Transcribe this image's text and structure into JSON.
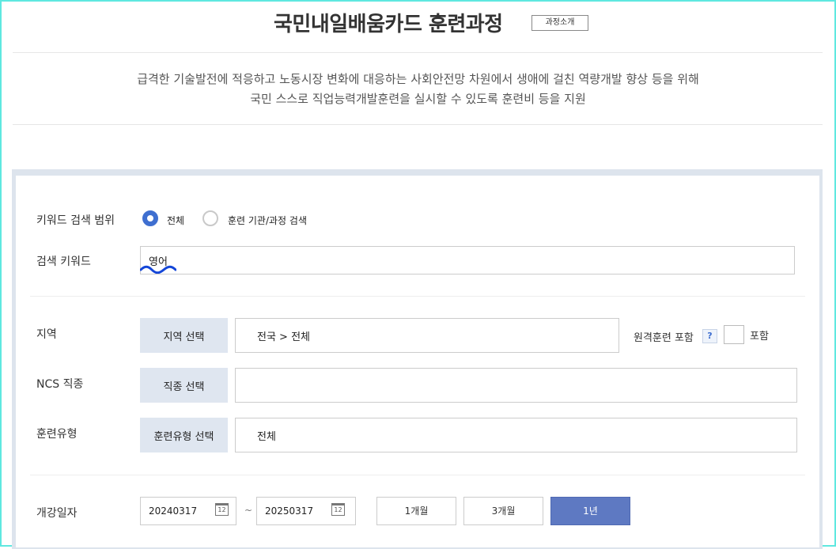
{
  "header": {
    "title": "국민내일배움카드 훈련과정",
    "intro_button": "과정소개"
  },
  "description": {
    "line1": "급격한 기술발전에 적응하고 노동시장 변화에 대응하는 사회안전망 차원에서 생애에 걸친 역량개발 향상 등을 위해",
    "line2": "국민 스스로 직업능력개발훈련을 실시할 수 있도록 훈련비 등을 지원"
  },
  "search": {
    "scope_label": "키워드 검색 범위",
    "scope_options": [
      {
        "label": "전체",
        "selected": true
      },
      {
        "label": "훈련 기관/과정 검색",
        "selected": false
      }
    ],
    "keyword_label": "검색 키워드",
    "keyword_value": "영어",
    "region_label": "지역",
    "region_button": "지역 선택",
    "region_value": "전국 > 전체",
    "remote_label": "원격훈련 포함",
    "remote_help": "?",
    "remote_checkbox_label": "포함",
    "remote_checked": false,
    "ncs_label": "NCS 직종",
    "ncs_button": "직종 선택",
    "ncs_value": "",
    "type_label": "훈련유형",
    "type_button": "훈련유형 선택",
    "type_value": "전체",
    "date_label": "개강일자",
    "date_start": "20240317",
    "date_separator": "~",
    "date_end": "20250317",
    "calendar_icon_text": "12",
    "periods": [
      "1개월",
      "3개월",
      "1년"
    ],
    "active_period": "1년"
  },
  "colors": {
    "frame": "#5fe8e0",
    "panel_bg": "#dde4ed",
    "button_bg": "#dfe6f0",
    "accent": "#3f6fd0",
    "active_period_bg": "#5e79c2"
  }
}
